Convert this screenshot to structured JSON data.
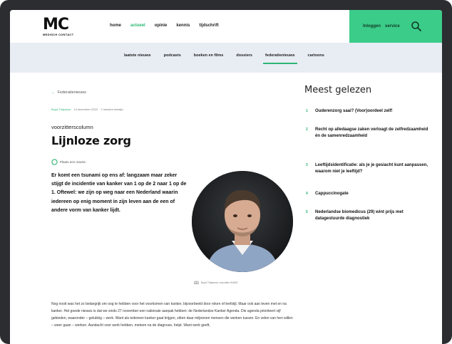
{
  "header": {
    "logo": "MC",
    "logo_sub": "MEDISCH CONTACT",
    "nav": [
      {
        "label": "home",
        "active": false
      },
      {
        "label": "actueel",
        "active": true
      },
      {
        "label": "opinie",
        "active": false
      },
      {
        "label": "kennis",
        "active": false
      },
      {
        "label": "tijdschrift",
        "active": false
      }
    ],
    "login": "Inloggen",
    "service": "service"
  },
  "subnav": [
    {
      "label": "laatste nieuws",
      "active": false
    },
    {
      "label": "podcasts",
      "active": false
    },
    {
      "label": "boeken en films",
      "active": false
    },
    {
      "label": "dossiers",
      "active": false
    },
    {
      "label": "federatienieuws",
      "active": true
    },
    {
      "label": "cartoons",
      "active": false
    }
  ],
  "article": {
    "back_link": "Federatienieuws",
    "author": "Boyd Thijssens",
    "date": "14 december 2023",
    "read_time": "2 minuten leestijd",
    "kicker": "voorzitterscolumn",
    "title": "Lijnloze zorg",
    "reply": "Plaats een reactie",
    "lead": "Er komt een tsunami op ens af: langzaam maar zeker stijgt de incidentie van kanker van 1 op de 2 naar 1 op de 1. Oftewel: we zijn op weg naar een Nederland waarin iedereen op enig moment in zijn leven aan de een of andere vorm van kanker lijdt.",
    "caption": "Boyd Thijssens, voorzitter KNMG",
    "body": "Nog nooit was het zo belangrijk om oog te hebben voor het voorkomen van kanker, bijvoorbeeld door roken of leefstijl. Maar ook aan leven met en na kanker. Het goede nieuws is dat we sinds 27 november een nationale aanpak hebben: de Nederlandse Kanker Agenda. Die agenda prioriteert vijf gebieden, waaronder – gelukkig – werk. Want als iedereen kanker gaat krijgen, zitten daar miljoenen mensen die werken tussen. En velen van hen willen – weer gaan – werken. Aandacht voor werk hebben, meteen na de diagnose, helpt. Want werk geeft,"
  },
  "sidebar": {
    "title": "Meest gelezen",
    "items": [
      {
        "num": "1",
        "text": "Ouderenzorg saai? (Voor)oordeel zelf!"
      },
      {
        "num": "2",
        "text": "Recht op alledaagse zaken verloagt de zelfredzaamheid én de samenredzaamheid"
      },
      {
        "num": "3",
        "text": "Leeftijdsidentificatie: als je je gesiacht kunt aanpassen, waarom niet je leeftijd?"
      },
      {
        "num": "4",
        "text": "Cappuccinogate"
      },
      {
        "num": "5",
        "text": "Nederlandse biomedicus (29) wint prijs met datagestuurde diagnostiek"
      }
    ]
  },
  "colors": {
    "accent": "#2bb673",
    "header_green": "#3ccc8a",
    "subnav_bg": "#e8edf4",
    "frame": "#2b2d31"
  }
}
